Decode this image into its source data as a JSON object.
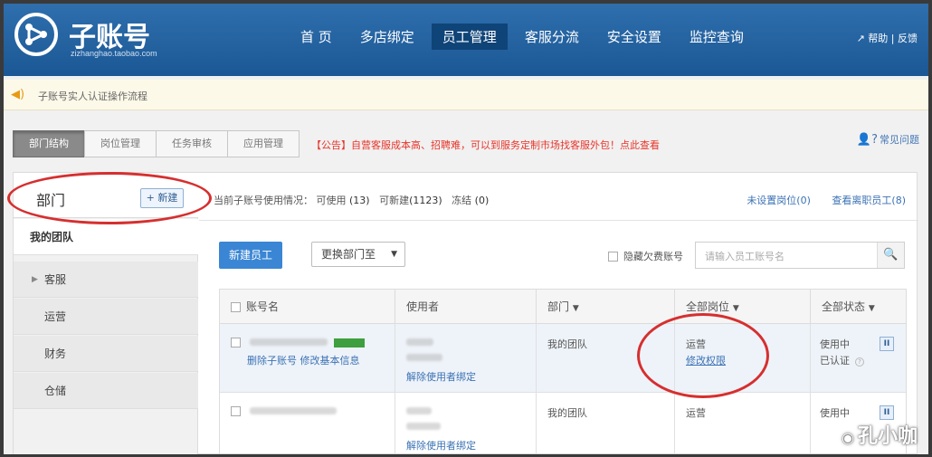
{
  "header": {
    "logo_title": "子账号",
    "logo_sub": "zizhanghao.taobao.com",
    "nav": [
      "首 页",
      "多店绑定",
      "员工管理",
      "客服分流",
      "安全设置",
      "监控查询"
    ],
    "active_nav": "员工管理",
    "help": "帮助",
    "feedback": "反馈"
  },
  "notice": {
    "text": "子账号实人认证操作流程"
  },
  "tabs": [
    "部门结构",
    "岗位管理",
    "任务审核",
    "应用管理"
  ],
  "announcement": "【公告】自营客服成本高、招聘难，可以到服务定制市场找客服外包！点此查看",
  "faq": "常见问题",
  "sidebar": {
    "title": "部门",
    "new_button": "+ 新建",
    "team": "我的团队",
    "items": [
      "客服",
      "运营",
      "财务",
      "仓储"
    ]
  },
  "usage": {
    "label": "当前子账号使用情况：",
    "available_label": "可使用",
    "available": "(13)",
    "new_label": "可新建",
    "new_count": "(1123)",
    "frozen_label": "冻结",
    "frozen": "(0)",
    "unset_post": "未设置岗位(0)",
    "resigned": "查看离职员工(8)"
  },
  "toolbar": {
    "add_employee": "新建员工",
    "move_dept": "更换部门至",
    "hide_arrears": "隐藏欠费账号",
    "search_placeholder": "请输入员工账号名"
  },
  "table": {
    "headers": [
      "账号名",
      "使用者",
      "部门",
      "全部岗位",
      "全部状态"
    ],
    "rows": [
      {
        "actions": "删除子账号 修改基本信息",
        "user_action": "解除使用者绑定",
        "dept": "我的团队",
        "post": "运营",
        "post_action": "修改权限",
        "status": "使用中",
        "verified": "已认证"
      },
      {
        "user_action": "解除使用者绑定",
        "dept": "我的团队",
        "post": "运营",
        "status": "使用中"
      }
    ]
  },
  "watermark": "孔小咖",
  "colors": {
    "header": "#2f6fad",
    "accent": "#3a86d4",
    "annotation": "#d62f2f",
    "announcement": "#e8352a"
  }
}
